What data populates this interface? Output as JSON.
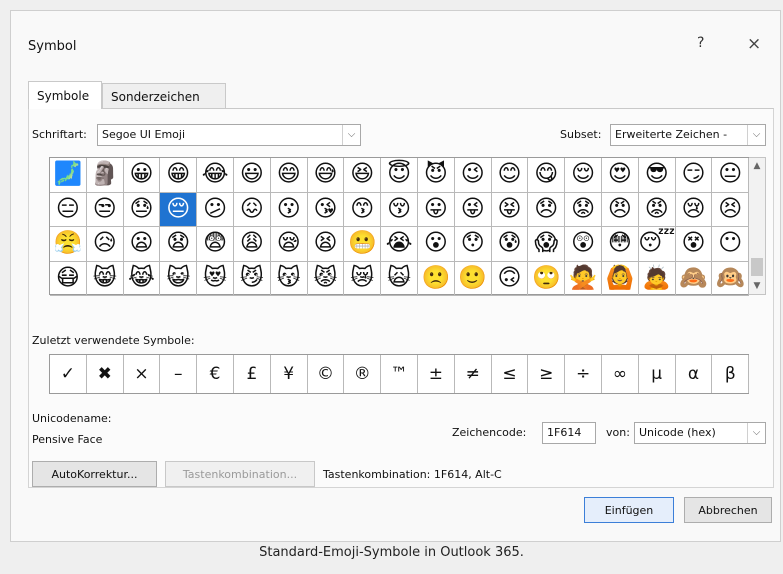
{
  "window": {
    "title": "Symbol",
    "help_label": "?",
    "close_label": "×"
  },
  "tabs": [
    {
      "label": "Symbole",
      "active": true
    },
    {
      "label": "Sonderzeichen",
      "active": false
    }
  ],
  "font": {
    "label": "Schriftart:",
    "value": "Segoe UI Emoji"
  },
  "subset": {
    "label": "Subset:",
    "value": "Erweiterte Zeichen -"
  },
  "symbol_grid": {
    "rows": [
      [
        "🗾",
        "🗿",
        "😀",
        "😁",
        "😂",
        "😃",
        "😄",
        "😅",
        "😆",
        "😇",
        "😈",
        "😉",
        "😊",
        "😋",
        "😌",
        "😍",
        "😎",
        "😏",
        "😐"
      ],
      [
        "😑",
        "😒",
        "😓",
        "😔",
        "😕",
        "😖",
        "😗",
        "😘",
        "😙",
        "😚",
        "😛",
        "😜",
        "😝",
        "😞",
        "😟",
        "😠",
        "😡",
        "😢",
        "😣"
      ],
      [
        "😤",
        "😥",
        "😦",
        "😧",
        "😨",
        "😩",
        "😪",
        "😫",
        "😬",
        "😭",
        "😮",
        "😯",
        "😰",
        "😱",
        "😲",
        "😳",
        "😴",
        "😵",
        "😶"
      ],
      [
        "😷",
        "😸",
        "😹",
        "😺",
        "😻",
        "😼",
        "😽",
        "😾",
        "😿",
        "🙀",
        "🙁",
        "🙂",
        "🙃",
        "🙄",
        "🙅",
        "🙆",
        "🙇",
        "🙈",
        "🙉"
      ]
    ],
    "selected": "😔"
  },
  "recent": {
    "label": "Zuletzt verwendete Symbole:",
    "items": [
      "✓",
      "✖",
      "×",
      "–",
      "€",
      "£",
      "¥",
      "©",
      "®",
      "™",
      "±",
      "≠",
      "≤",
      "≥",
      "÷",
      "∞",
      "µ",
      "α",
      "β"
    ]
  },
  "unicode_name_label": "Unicodename:",
  "unicode_name": "Pensive Face",
  "char_code": {
    "label": "Zeichencode:",
    "value": "1F614"
  },
  "from": {
    "label": "von:",
    "value": "Unicode (hex)"
  },
  "buttons": {
    "autocorrect": "AutoKorrektur...",
    "shortcut_key": "Tastenkombination...",
    "insert": "Einfügen",
    "cancel": "Abbrechen"
  },
  "shortcut_text": "Tastenkombination: 1F614, Alt-C",
  "caption": "Standard-Emoji-Symbole in Outlook 365."
}
